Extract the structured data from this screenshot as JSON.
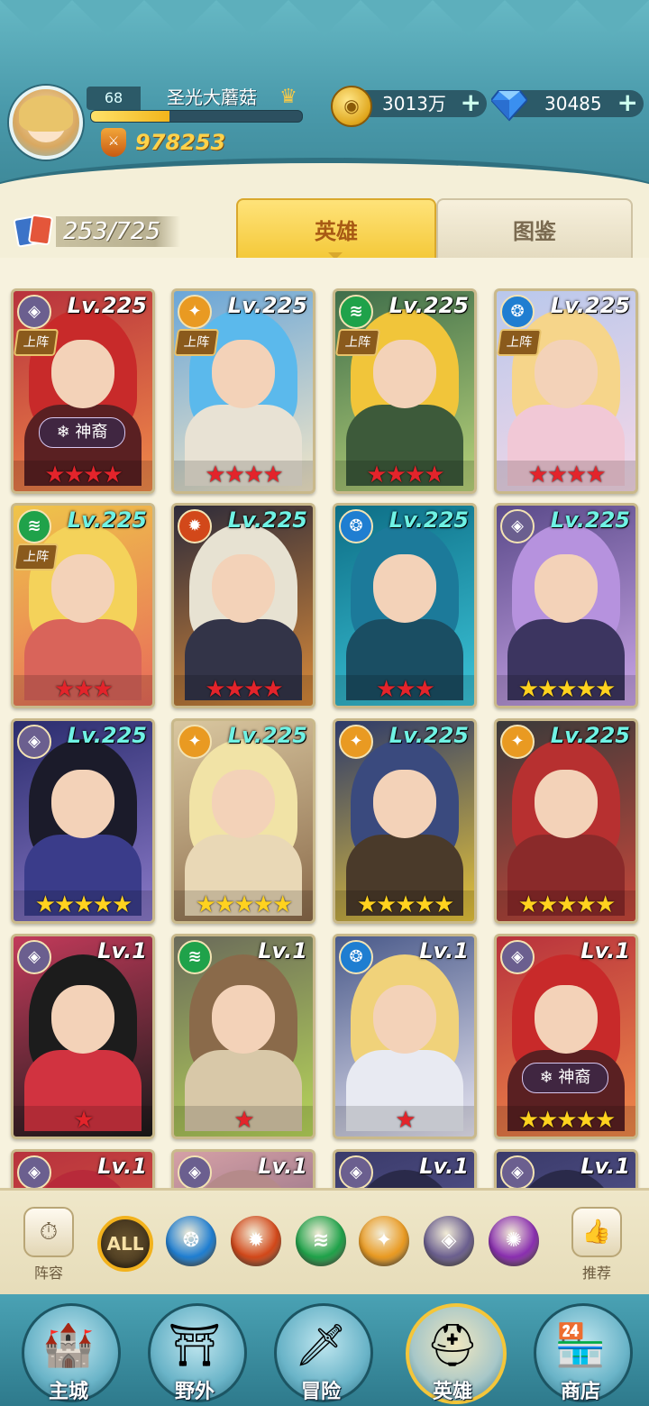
{
  "player": {
    "level": "68",
    "name": "圣光大蘑菇",
    "xp_fraction": 0.37,
    "power": "978253"
  },
  "resources": {
    "gold": "3013万",
    "diamonds": "30485"
  },
  "collection": {
    "count": "253/725"
  },
  "tabs": {
    "heroes": "英雄",
    "codex": "图鉴"
  },
  "labels": {
    "deploy": "上阵",
    "divine": "神裔"
  },
  "element_colors": {
    "void": "#6b5f8f",
    "light": "#e99a22",
    "nature": "#1fa24a",
    "water": "#1f7ed1",
    "fire": "#d2481a",
    "shadow": "#8a2fb0"
  },
  "heroes": [
    {
      "level": "Lv.225",
      "element": "void",
      "deployed": true,
      "divine": true,
      "stars": 4,
      "star_color": "red",
      "bg": [
        "#b8323c",
        "#f08a4a"
      ],
      "hair": "#c82a2a",
      "body": "#5a2022"
    },
    {
      "level": "Lv.225",
      "element": "light",
      "deployed": true,
      "divine": false,
      "stars": 4,
      "star_color": "red",
      "bg": [
        "#6aa6d8",
        "#f2e6c8"
      ],
      "hair": "#5bb9ec",
      "body": "#e8e2d4"
    },
    {
      "level": "Lv.225",
      "element": "nature",
      "deployed": true,
      "divine": false,
      "stars": 4,
      "star_color": "red",
      "bg": [
        "#3f6e4a",
        "#b8d27a"
      ],
      "hair": "#f1c53a",
      "body": "#3d5a3a"
    },
    {
      "level": "Lv.225",
      "element": "water",
      "deployed": true,
      "divine": false,
      "stars": 4,
      "star_color": "red",
      "bg": [
        "#b9c8ec",
        "#f5d7e6"
      ],
      "hair": "#f6d58a",
      "body": "#f1c8d6"
    },
    {
      "level": "Lv.225",
      "element": "nature",
      "deployed": true,
      "divine": false,
      "stars": 3,
      "star_color": "red",
      "bg": [
        "#efc54a",
        "#e86a5a"
      ],
      "hair": "#f4d25a",
      "body": "#d9645a"
    },
    {
      "level": "Lv.225",
      "element": "fire",
      "deployed": false,
      "divine": false,
      "stars": 4,
      "star_color": "red",
      "bg": [
        "#2d2b3a",
        "#d88a3a"
      ],
      "hair": "#e7e2d2",
      "body": "#333448"
    },
    {
      "level": "Lv.225",
      "element": "water",
      "deployed": false,
      "divine": false,
      "stars": 3,
      "star_color": "red",
      "bg": [
        "#0d6e86",
        "#3cc4d8"
      ],
      "hair": "#1c7a9a",
      "body": "#1a4e63"
    },
    {
      "level": "Lv.225",
      "element": "void",
      "deployed": false,
      "divine": false,
      "stars": 5,
      "star_color": "gold",
      "bg": [
        "#5a4a8a",
        "#c9a5e6"
      ],
      "hair": "#b692de",
      "body": "#3c3560"
    },
    {
      "level": "Lv.225",
      "element": "void",
      "deployed": false,
      "divine": false,
      "stars": 5,
      "star_color": "gold",
      "bg": [
        "#2b2d6e",
        "#8a79c8"
      ],
      "hair": "#1b1b2a",
      "body": "#3a3c8a"
    },
    {
      "level": "Lv.225",
      "element": "light",
      "deployed": false,
      "divine": false,
      "stars": 5,
      "star_color": "gold",
      "bg": [
        "#d9c7a0",
        "#8a6a4a"
      ],
      "hair": "#f1e3a6",
      "body": "#e9d8b6"
    },
    {
      "level": "Lv.225",
      "element": "light",
      "deployed": false,
      "divine": false,
      "stars": 5,
      "star_color": "gold",
      "bg": [
        "#2d3a6a",
        "#e6c43a"
      ],
      "hair": "#3a4a7e",
      "body": "#4a3a2a"
    },
    {
      "level": "Lv.225",
      "element": "light",
      "deployed": false,
      "divine": false,
      "stars": 5,
      "star_color": "gold",
      "bg": [
        "#3a3a3a",
        "#c7473a"
      ],
      "hair": "#b73030",
      "body": "#8a2a2a"
    },
    {
      "level": "Lv.1",
      "element": "void",
      "deployed": false,
      "divine": false,
      "stars": 1,
      "star_color": "red",
      "bg": [
        "#c23a5a",
        "#1a1a1a"
      ],
      "hair": "#1c1c1c",
      "body": "#d13340"
    },
    {
      "level": "Lv.1",
      "element": "nature",
      "deployed": false,
      "divine": false,
      "stars": 1,
      "star_color": "red",
      "bg": [
        "#6a6a5a",
        "#b8d65a"
      ],
      "hair": "#8a6a4a",
      "body": "#d8c8a8"
    },
    {
      "level": "Lv.1",
      "element": "water",
      "deployed": false,
      "divine": false,
      "stars": 1,
      "star_color": "red",
      "bg": [
        "#4a5a8a",
        "#e8e6f2"
      ],
      "hair": "#f0d27a",
      "body": "#e8eaf2"
    },
    {
      "level": "Lv.1",
      "element": "void",
      "deployed": false,
      "divine": true,
      "stars": 5,
      "star_color": "gold",
      "bg": [
        "#b8323c",
        "#f08a4a"
      ],
      "hair": "#c82a2a",
      "body": "#5a2022"
    },
    {
      "level": "Lv.1",
      "element": "void",
      "deployed": false,
      "divine": false,
      "stars": 0,
      "star_color": "red",
      "bg": [
        "#b8323c",
        "#e06a4a"
      ],
      "hair": "#b82a3a",
      "body": "#5a2022"
    },
    {
      "level": "Lv.1",
      "element": "void",
      "deployed": false,
      "divine": false,
      "stars": 0,
      "star_color": "red",
      "bg": [
        "#d5a0a6",
        "#5a4a6a"
      ],
      "hair": "#b58a8a",
      "body": "#6a4a5a"
    },
    {
      "level": "Lv.1",
      "element": "void",
      "deployed": false,
      "divine": false,
      "stars": 0,
      "star_color": "red",
      "bg": [
        "#3a3a6a",
        "#6a6aa8"
      ],
      "hair": "#2a2a4a",
      "body": "#3a3a6a"
    },
    {
      "level": "Lv.1",
      "element": "void",
      "deployed": false,
      "divine": false,
      "stars": 0,
      "star_color": "red",
      "bg": [
        "#3a3a6a",
        "#6a6aa8"
      ],
      "hair": "#2a2a4a",
      "body": "#3a3a6a"
    }
  ],
  "filters": {
    "lineup_label": "阵容",
    "all_label": "ALL",
    "recommend_label": "推荐",
    "elements": [
      "water",
      "fire",
      "nature",
      "light",
      "void",
      "shadow"
    ]
  },
  "nav": [
    {
      "label": "主城",
      "icon": "castle-icon",
      "glyph": "🏰",
      "active": false
    },
    {
      "label": "野外",
      "icon": "portal-icon",
      "glyph": "⛩",
      "active": false
    },
    {
      "label": "冒险",
      "icon": "sword-icon",
      "glyph": "🗡",
      "active": false
    },
    {
      "label": "英雄",
      "icon": "knight-helmet-icon",
      "glyph": "⛑",
      "active": true
    },
    {
      "label": "商店",
      "icon": "shop-icon",
      "glyph": "🏪",
      "active": false
    }
  ]
}
